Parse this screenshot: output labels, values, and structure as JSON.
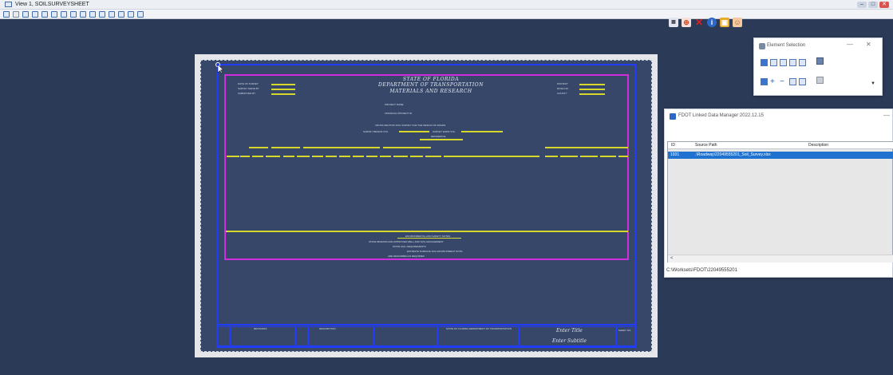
{
  "window": {
    "title": "View 1, SOILSURVEYSHEET",
    "controls": [
      "–",
      "□",
      "✕"
    ]
  },
  "sheet": {
    "state": "STATE OF FLORIDA",
    "dept": "DEPARTMENT OF TRANSPORTATION",
    "division": "MATERIALS AND RESEARCH",
    "project_name_label": "PROJECT NAME",
    "financial_project_label": "FINANCIAL PROJECT ID",
    "survey_heading": "CROSS SECTION SOIL SURVEY FOR THE DESIGN OF ROADS",
    "left_labels": [
      "DATE OF SURVEY",
      "SURVEY MADE BY",
      "SUBMITTED BY"
    ],
    "right_labels": [
      "DISTRICT",
      "ROAD NO.",
      "COUNTY"
    ],
    "survey_begin": "SURVEY BEGINS STA.",
    "survey_ends": "SURVEY ENDS STA.",
    "reference": "REFERENCE",
    "footer_heading": "ENVIRONMENTAL AND SAFETY NOTES",
    "footer_lines": [
      "STATE MINIMUM AND APPROVED WELL AND SOIL MANAGEMENT",
      "STATE SOIL REQUIREMENTS",
      "ESTIMATE SURFACE SOIL ENVIRONMENT NOTE",
      "ARE DESCRIBED AS REQUIRED"
    ],
    "tb_dept": "STATE OF FLORIDA DEPARTMENT OF TRANSPORTATION",
    "tb_left_1": "REVISIONS",
    "tb_left_2": "DESCRIPTION",
    "tb_sheet_title": "Enter Title",
    "tb_sheet_subtitle": "Enter Subtitle",
    "tb_sheet_no_label": "SHEET NO."
  },
  "element_selection": {
    "title": "Element Selection",
    "min": "—",
    "close": "✕"
  },
  "fdot_panel": {
    "title": "FDOT Linked Data Manager 2022.12.15",
    "min": "—",
    "columns": [
      "ID",
      "Source Path",
      "Description"
    ],
    "rows": [
      {
        "id": "1931",
        "source_path": ".\\Roadway\\22049555201_Soil_Survey.xlsx",
        "description": ""
      }
    ],
    "scroll_left": "<",
    "status_path": "C:\\Worksets\\FDOT\\22049555201"
  },
  "colors": {
    "view_bg": "#2b3a57",
    "blue_frame": "#1f3cff",
    "magenta_frame": "#d22ddd",
    "yellow_line": "#d7d82b",
    "selection_row": "#1f72cf"
  }
}
